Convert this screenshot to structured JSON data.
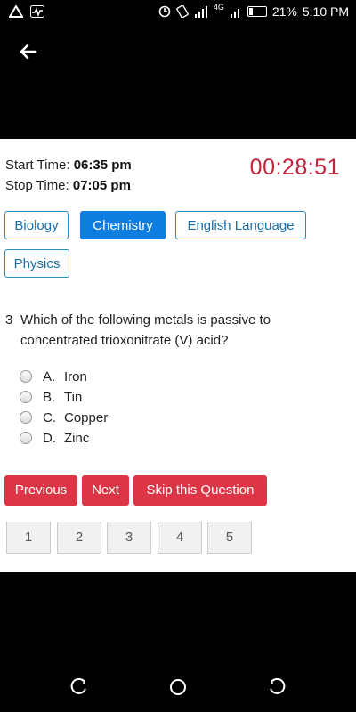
{
  "status_bar": {
    "network": "4G",
    "battery": "21%",
    "time": "5:10 PM"
  },
  "quiz": {
    "start_label": "Start Time:",
    "start_time": "06:35 pm",
    "stop_label": "Stop Time:",
    "stop_time": "07:05 pm",
    "countdown": "00:28:51"
  },
  "subjects": [
    {
      "label": "Biology",
      "active": false
    },
    {
      "label": "Chemistry",
      "active": true
    },
    {
      "label": "English Language",
      "active": false
    },
    {
      "label": "Physics",
      "active": false
    }
  ],
  "question": {
    "number": "3",
    "text": "Which of the following metals is passive to concentrated trioxonitrate (V) acid?",
    "options": [
      {
        "letter": "A.",
        "text": "Iron"
      },
      {
        "letter": "B.",
        "text": "Tin"
      },
      {
        "letter": "C.",
        "text": "Copper"
      },
      {
        "letter": "D.",
        "text": "Zinc"
      }
    ]
  },
  "actions": {
    "previous": "Previous",
    "next": "Next",
    "skip": "Skip this Question"
  },
  "pages": [
    "1",
    "2",
    "3",
    "4",
    "5"
  ],
  "colors": {
    "accent": "#0d7de0",
    "danger": "#dc3545",
    "timer": "#c8213b"
  }
}
